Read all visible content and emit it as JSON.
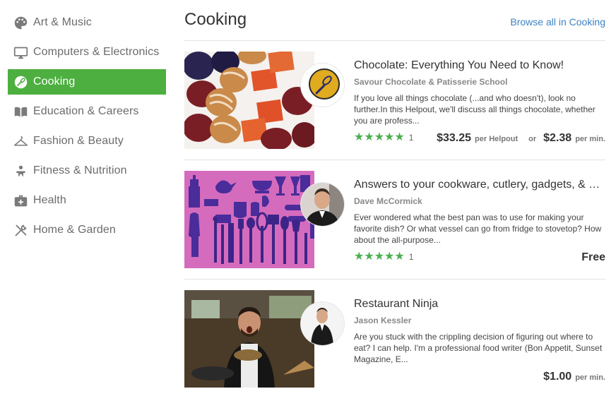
{
  "sidebar": {
    "items": [
      {
        "label": "Art & Music",
        "icon": "palette-icon"
      },
      {
        "label": "Computers & Electronics",
        "icon": "monitor-icon"
      },
      {
        "label": "Cooking",
        "icon": "cooking-whisk-icon",
        "active": true
      },
      {
        "label": "Education & Careers",
        "icon": "open-book-icon"
      },
      {
        "label": "Fashion & Beauty",
        "icon": "hanger-icon"
      },
      {
        "label": "Fitness & Nutrition",
        "icon": "fitness-person-icon"
      },
      {
        "label": "Health",
        "icon": "medical-kit-icon"
      },
      {
        "label": "Home & Garden",
        "icon": "tools-icon"
      }
    ],
    "accent_color": "#4caf3f"
  },
  "main": {
    "title": "Cooking",
    "browse_label": "Browse all in Cooking",
    "link_color": "#3d82c4",
    "cards": [
      {
        "title": "Chocolate: Everything You Need to Know!",
        "author": "Savour Chocolate & Patisserie School",
        "description": "If you love all things chocolate (...and who doesn't), look no further.In this Helpout, we'll discuss all things chocolate, whether you are profess...",
        "stars": "★★★★★",
        "rating_count": "1",
        "price": "$33.25",
        "price_unit": "per Helpout",
        "or_label": "or",
        "price_alt": "$2.38",
        "price_alt_unit": "per min."
      },
      {
        "title": "Answers to your cookware, cutlery, gadgets, & co...",
        "author": "Dave McCormick",
        "description": "Ever wondered what the best pan was to use for making your favorite dish? Or what vessel can go from fridge to stovetop?  How about the all-purpose...",
        "stars": "★★★★★",
        "rating_count": "1",
        "price": "Free"
      },
      {
        "title": "Restaurant Ninja",
        "author": "Jason Kessler",
        "description": "Are you stuck with the crippling decision of figuring out where to eat? I can help. I'm a professional food writer (Bon Appetit, Sunset Magazine, E...",
        "price": "$1.00",
        "price_unit": "per min."
      }
    ]
  }
}
